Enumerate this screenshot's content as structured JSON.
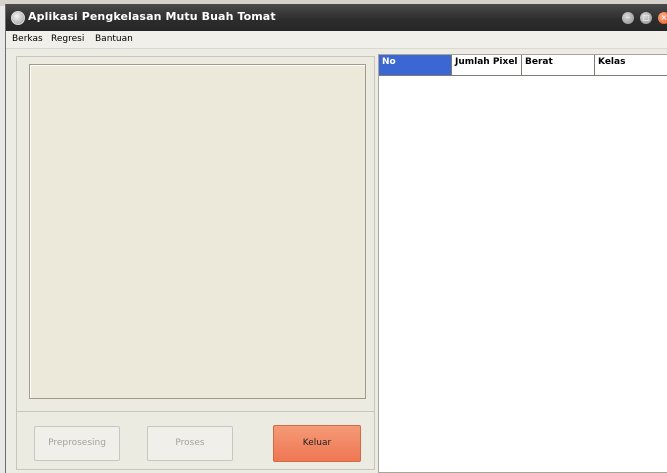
{
  "window": {
    "title": "Aplikasi Pengkelasan Mutu Buah Tomat"
  },
  "menu": {
    "items": [
      "Berkas",
      "Regresi",
      "Bantuan"
    ]
  },
  "buttons": {
    "preprocess_label": "Preprosesing",
    "process_label": "Proses",
    "exit_label": "Keluar"
  },
  "table": {
    "columns": [
      "No",
      "Jumlah Pixel",
      "Berat",
      "Kelas"
    ],
    "rows": []
  },
  "colors": {
    "selected_header": "#3a67d1",
    "exit_button": "#ef7752",
    "window_bg": "#ecebe4"
  }
}
